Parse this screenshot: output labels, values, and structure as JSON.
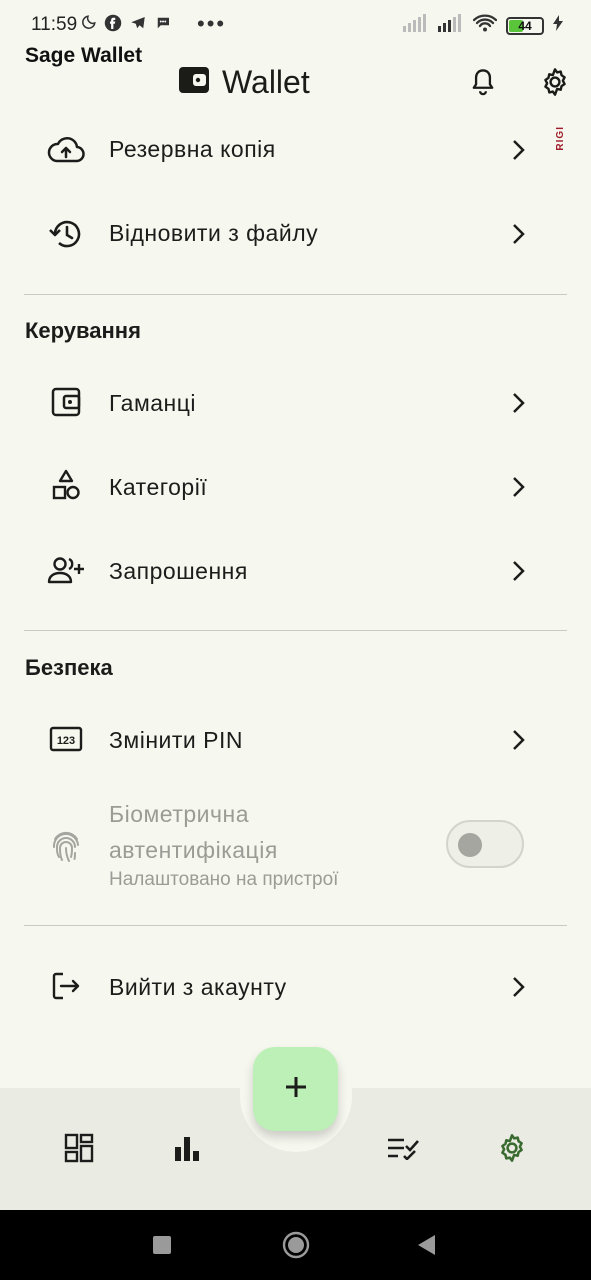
{
  "status_bar": {
    "time": "11:59",
    "battery_level": "44",
    "battery_fill_fraction": 0.44,
    "dots": "•••"
  },
  "overlay_label": "Sage Wallet",
  "side_tag": "RIGI",
  "app_bar": {
    "title": "Wallet",
    "icons": [
      "wallet-icon",
      "bell-icon",
      "gear-icon"
    ]
  },
  "backup": {
    "items": [
      {
        "label": "Резервна копія",
        "icon": "cloud-upload-icon"
      },
      {
        "label": "Відновити з файлу",
        "icon": "history-icon"
      }
    ]
  },
  "management": {
    "header": "Керування",
    "items": [
      {
        "label": "Гаманці",
        "icon": "wallet-icon"
      },
      {
        "label": "Категорії",
        "icon": "shapes-icon"
      },
      {
        "label": "Запрошення",
        "icon": "person-add-icon"
      }
    ]
  },
  "security": {
    "header": "Безпека",
    "change_pin": {
      "label": "Змінити PIN",
      "icon": "pin-123-icon"
    },
    "biometric": {
      "title": "Біометрична автентифікація",
      "subtitle": "Налаштовано на пристрої",
      "icon": "fingerprint-icon",
      "enabled": false
    }
  },
  "logout": {
    "label": "Вийти з акаунту",
    "icon": "logout-icon"
  },
  "bottom_nav": {
    "items": [
      "dashboard-icon",
      "bar-chart-icon",
      "checklist-icon",
      "gear-icon"
    ],
    "active": "gear-icon",
    "fab_icon": "plus-icon"
  },
  "colors": {
    "background": "#f6f8f0",
    "fab": "#bdf0b6",
    "active_nav": "#3a6b30",
    "disabled_text": "#9a9c95",
    "divider": "#c9cbc2"
  }
}
